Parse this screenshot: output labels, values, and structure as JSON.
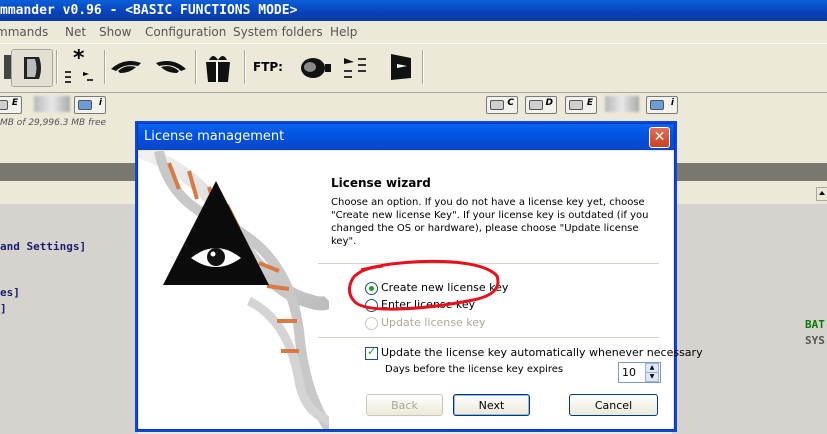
{
  "window": {
    "title": "mmander v0.96 - <BASIC FUNCTIONS MODE>"
  },
  "menu": [
    "mmands",
    "Net",
    "Show",
    "Configuration",
    "System folders",
    "Help"
  ],
  "toolbar": {
    "ftp_label": "FTP:"
  },
  "drives_left": {
    "drive_e": "E",
    "drive_net": "i",
    "free_text": "MB of  29,996.3 MB free"
  },
  "drives_right": {
    "drive_c": "C",
    "drive_d": "D",
    "drive_e": "E",
    "drive_net": "i"
  },
  "left_panel": {
    "lines": [
      "and Settings]",
      "es]",
      "]"
    ]
  },
  "right_panel": {
    "lines": [
      "BAT",
      "SYS"
    ]
  },
  "dialog": {
    "title": "License management",
    "close_label": "✕",
    "heading": "License wizard",
    "description": "Choose an option. If you do not have a license key yet, choose \"Create new license Key\". If your license key is outdated (if you changed the OS or hardware), please choose \"Update license key\".",
    "options": [
      {
        "label": "Create new license key",
        "checked": true,
        "disabled": false
      },
      {
        "label": "Enter license key",
        "checked": false,
        "disabled": false
      },
      {
        "label": "Update license key",
        "checked": false,
        "disabled": true
      }
    ],
    "auto_update_label": "Update the license key automatically whenever necessary",
    "auto_update_checked": true,
    "days_label": "Days before the license key expires",
    "days_value": "10",
    "buttons": {
      "back": "Back",
      "next": "Next",
      "cancel": "Cancel"
    }
  },
  "annotation_color": "#e8101c"
}
